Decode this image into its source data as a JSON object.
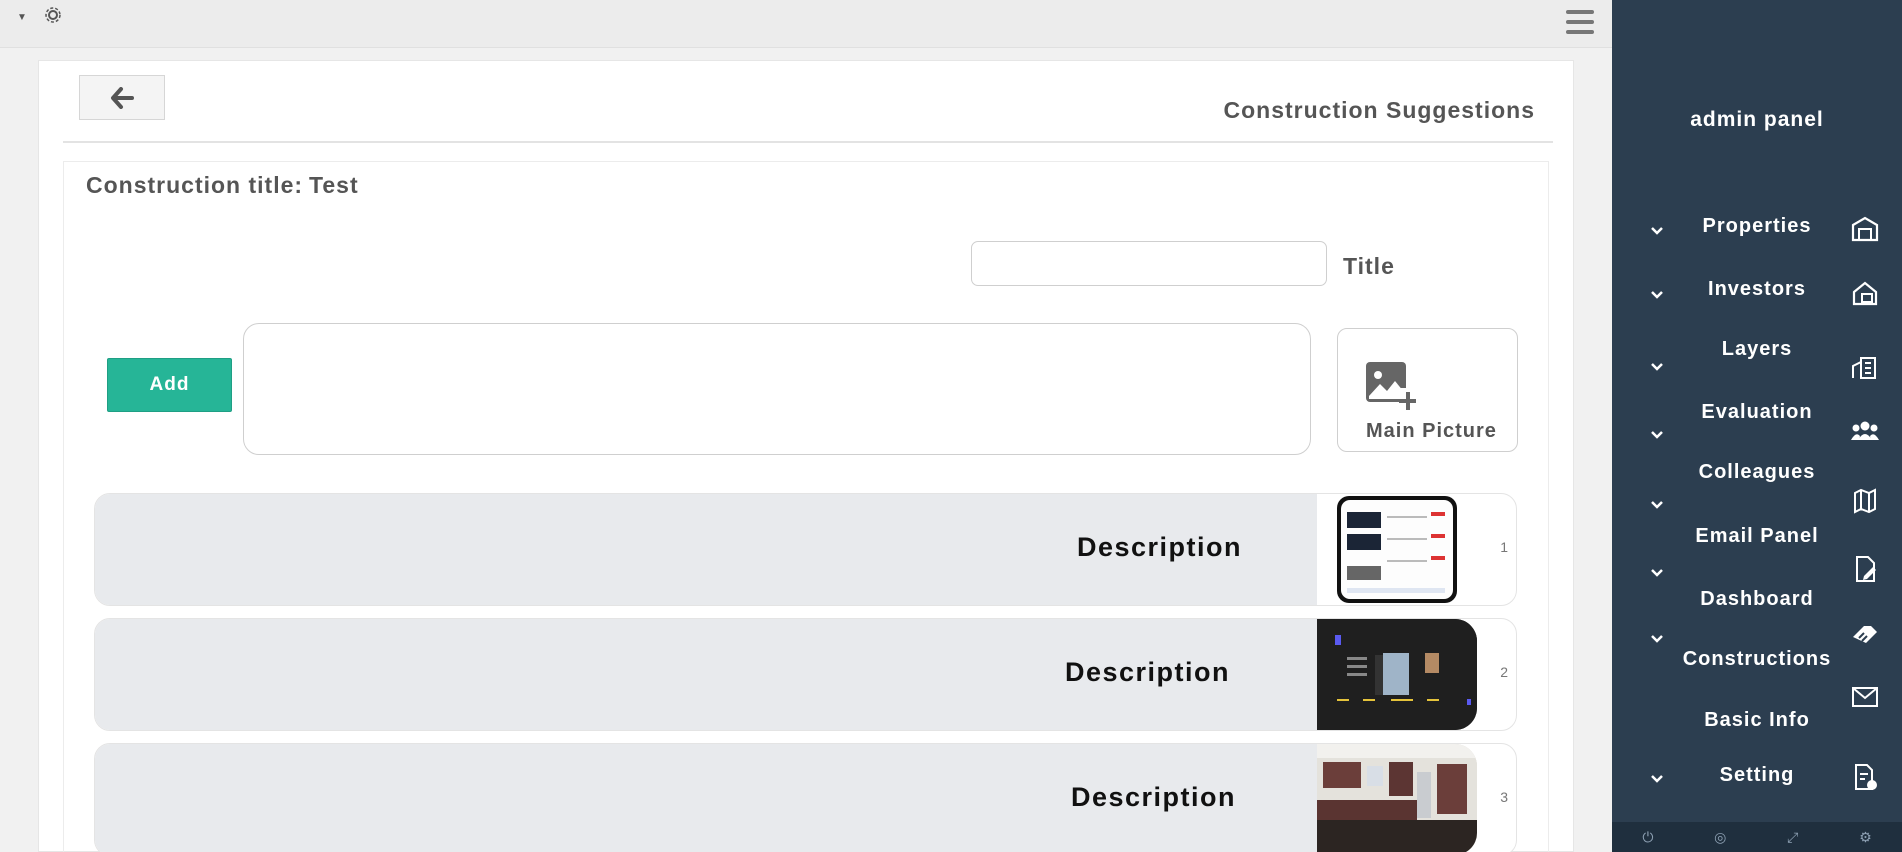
{
  "topbar": {
    "caret_icon": "caret-down-icon",
    "settings_icon": "gear-icon",
    "menu_icon": "hamburger-menu-icon"
  },
  "header": {
    "back_icon": "arrow-left-icon",
    "page_title": "Construction Suggestions"
  },
  "construction": {
    "title_label": "Construction title:",
    "title_value": "Test"
  },
  "form": {
    "title_label": "Title",
    "title_value": "",
    "description_value": "",
    "add_label": "Add",
    "main_picture_label": "Main Picture",
    "main_picture_icon": "image-add-icon"
  },
  "suggestions": [
    {
      "index": "1",
      "description": "Description",
      "thumb": "phone-screenshot"
    },
    {
      "index": "2",
      "description": "Description",
      "thumb": "dark-presentation"
    },
    {
      "index": "3",
      "description": "Description",
      "thumb": "kitchen-photo"
    }
  ],
  "sidebar": {
    "title": "admin panel",
    "items": [
      {
        "label": "Properties",
        "icon": "warehouse-icon"
      },
      {
        "label": "Investors",
        "icon": "house-chart-icon"
      },
      {
        "label": "Layers",
        "icon": "city-buildings-icon"
      },
      {
        "label": "Evaluation",
        "icon": "users-group-icon"
      },
      {
        "label": "Colleagues",
        "icon": "map-icon"
      },
      {
        "label": "Email Panel",
        "icon": "file-edit-icon"
      },
      {
        "label": "Dashboard",
        "icon": "handshake-icon"
      },
      {
        "label": "Constructions",
        "icon": "envelope-icon"
      },
      {
        "label": "Basic Info",
        "icon": "file-info-icon"
      },
      {
        "label": "Setting",
        "icon": ""
      }
    ],
    "footer_icons": [
      "power-icon",
      "eye-slash-icon",
      "expand-icon",
      "gear-icon"
    ]
  },
  "colors": {
    "sidebar_bg": "#2c3e50",
    "add_button": "#26b597",
    "row_bg": "#e8eaed"
  }
}
